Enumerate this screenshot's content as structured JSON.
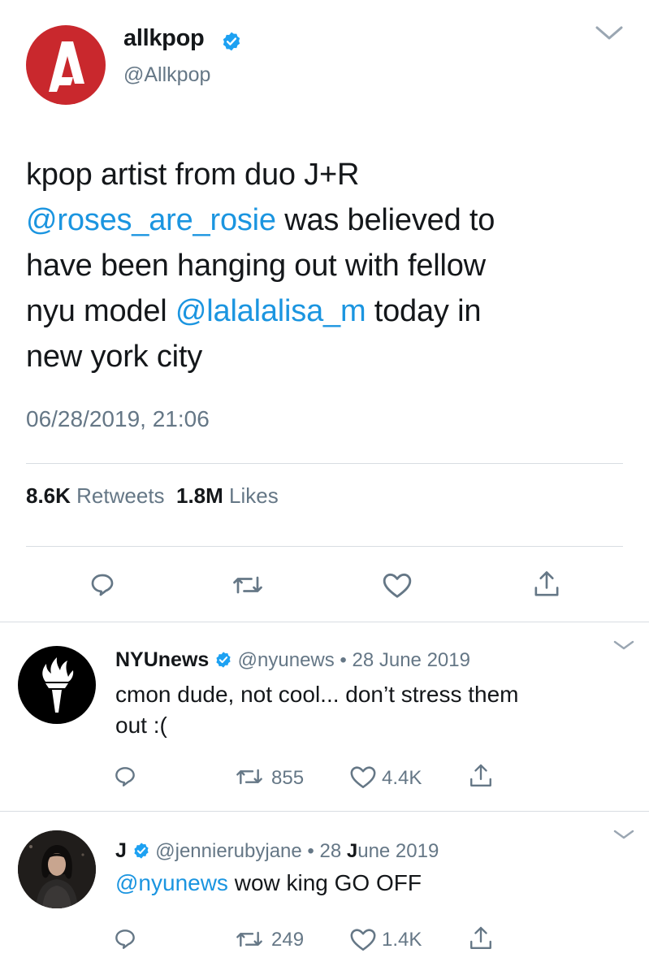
{
  "main_tweet": {
    "display_name": "allkpop",
    "handle": "@Allkpop",
    "text_lines": [
      [
        {
          "t": "kpop artist from duo J+R",
          "link": false
        }
      ],
      [
        {
          "t": "@roses_are_rosie",
          "link": true
        },
        {
          "t": " was believed to",
          "link": false
        }
      ],
      [
        {
          "t": "have been hanging out with fellow",
          "link": false
        }
      ],
      [
        {
          "t": "nyu model ",
          "link": false
        },
        {
          "t": "@lalalalisa_m",
          "link": true
        },
        {
          "t": " today in",
          "link": false
        }
      ],
      [
        {
          "t": "new york city",
          "link": false
        }
      ]
    ],
    "timestamp": "06/28/2019, 21:06",
    "retweets_count": "8.6K",
    "retweets_label": "Retweets",
    "likes_count": "1.8M",
    "likes_label": "Likes"
  },
  "replies": [
    {
      "display_name": "NYUnews",
      "handle": "@nyunews",
      "separator": "•",
      "date": "28 June 2019",
      "text_line1": "cmon dude, not cool... don’t stress them",
      "text_line2": "out :(",
      "retweets": "855",
      "likes": "4.4K"
    },
    {
      "display_name": "J",
      "handle": "@jennierubyjane",
      "separator": "•",
      "date_prefix": "28 ",
      "date_bold": "J",
      "date_suffix": "une 2019",
      "mention": "@nyunews",
      "text_rest": " wow king GO OFF",
      "retweets": "249",
      "likes": "1.4K"
    }
  ],
  "colors": {
    "link": "#1b95e0",
    "muted": "#657786",
    "allkpop_red": "#c9282d",
    "verified": "#1da1f2"
  },
  "icons": [
    "allkpop-logo",
    "verified-badge-icon",
    "chevron-down-icon",
    "reply-icon",
    "retweet-icon",
    "like-icon",
    "share-icon",
    "nyu-torch-logo"
  ]
}
